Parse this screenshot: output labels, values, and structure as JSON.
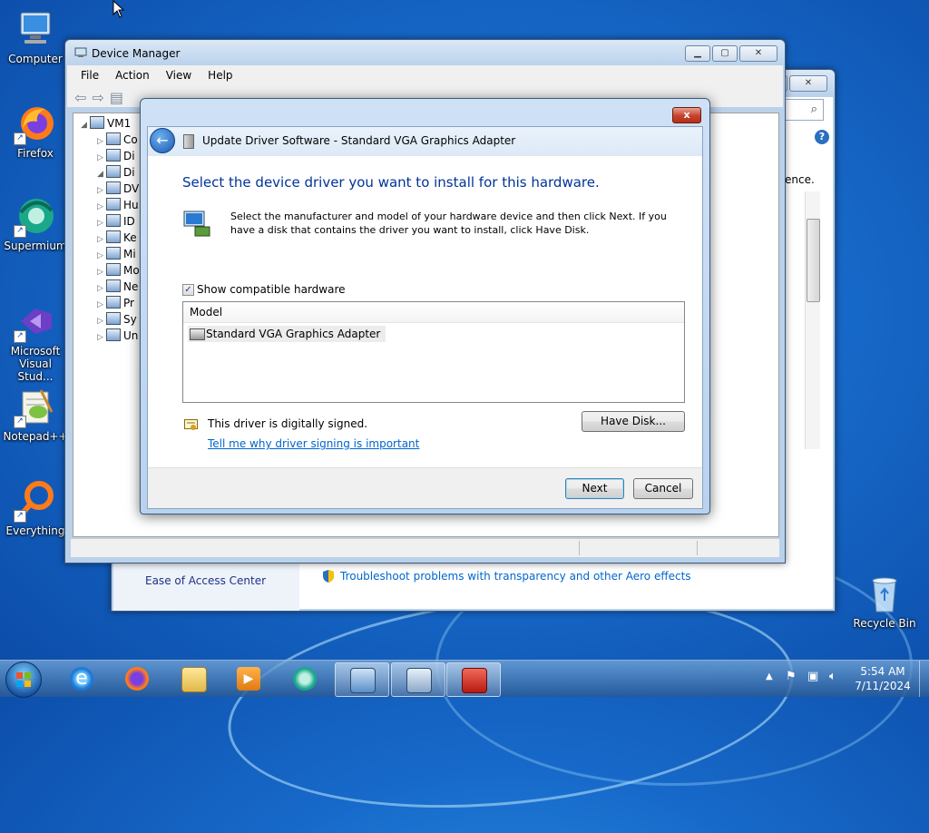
{
  "desktop": {
    "icons": [
      {
        "label": "Computer"
      },
      {
        "label": "Firefox"
      },
      {
        "label": "Supermium"
      },
      {
        "label": "Microsoft Visual Studio Code",
        "display": "Microsoft\nVisual Stud..."
      },
      {
        "label": "Notepad++"
      },
      {
        "label": "Everything"
      },
      {
        "label": "Recycle Bin"
      }
    ]
  },
  "device_manager": {
    "title": "Device Manager",
    "menu": [
      "File",
      "Action",
      "View",
      "Help"
    ],
    "tree_root": "VM1",
    "tree_items": [
      "Co",
      "Di",
      "Di",
      "DV",
      "Hu",
      "ID",
      "Ke",
      "Mi",
      "Mo",
      "Ne",
      "Pr",
      "Sy",
      "Un"
    ]
  },
  "background_window": {
    "partial_text": "ence.",
    "ease_of_access": "Ease of Access Center",
    "troubleshoot_link": "Troubleshoot problems with transparency and other Aero effects"
  },
  "dialog": {
    "title": "Update Driver Software - Standard VGA Graphics Adapter",
    "heading": "Select the device driver you want to install for this hardware.",
    "description": "Select the manufacturer and model of your hardware device and then click Next. If you have a disk that contains the driver you want to install, click Have Disk.",
    "show_compatible_label": "Show compatible hardware",
    "show_compatible_checked": true,
    "model_header": "Model",
    "models": [
      "Standard VGA Graphics Adapter"
    ],
    "signed_text": "This driver is digitally signed.",
    "signing_link": "Tell me why driver signing is important",
    "have_disk_label": "Have Disk...",
    "next_label": "Next",
    "cancel_label": "Cancel",
    "close_glyph": "x"
  },
  "taskbar": {
    "time": "5:54 AM",
    "date": "7/11/2024"
  },
  "colors": {
    "link": "#0066cc",
    "heading": "#003399"
  }
}
